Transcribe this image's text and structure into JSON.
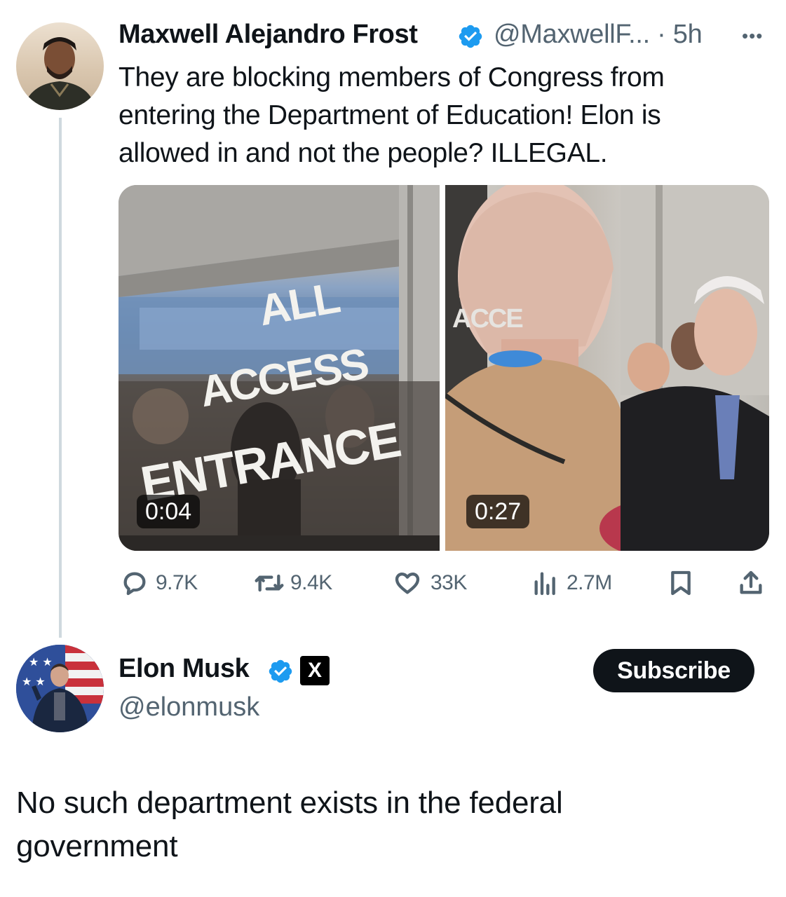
{
  "tweet": {
    "author_name": "Maxwell Alejandro Frost",
    "handle_time": "@MaxwellF... · 5h",
    "verified_icon": "verified-badge-icon",
    "more_icon": "more-options-icon",
    "text": "They are blocking members of Congress from entering the Department of Education! Elon is allowed in and not the people? ILLEGAL.",
    "media": [
      {
        "duration": "0:04",
        "sign_lines": [
          "ALL",
          "ACCESS",
          "ENTRANCE"
        ]
      },
      {
        "duration": "0:27",
        "sign_lines": [
          "ACCE"
        ]
      }
    ],
    "stats": {
      "replies": "9.7K",
      "reposts": "9.4K",
      "likes": "33K",
      "views": "2.7M"
    }
  },
  "reply": {
    "author_name": "Elon Musk",
    "handle": "@elonmusk",
    "verified_icon": "verified-badge-icon",
    "affiliate_badge": "X",
    "subscribe_label": "Subscribe",
    "text": "No such department exists in the federal government"
  },
  "colors": {
    "text_primary": "#0f1419",
    "text_secondary": "#536471",
    "verified_blue": "#1d9bf0",
    "thread_line": "#cfd9de"
  }
}
